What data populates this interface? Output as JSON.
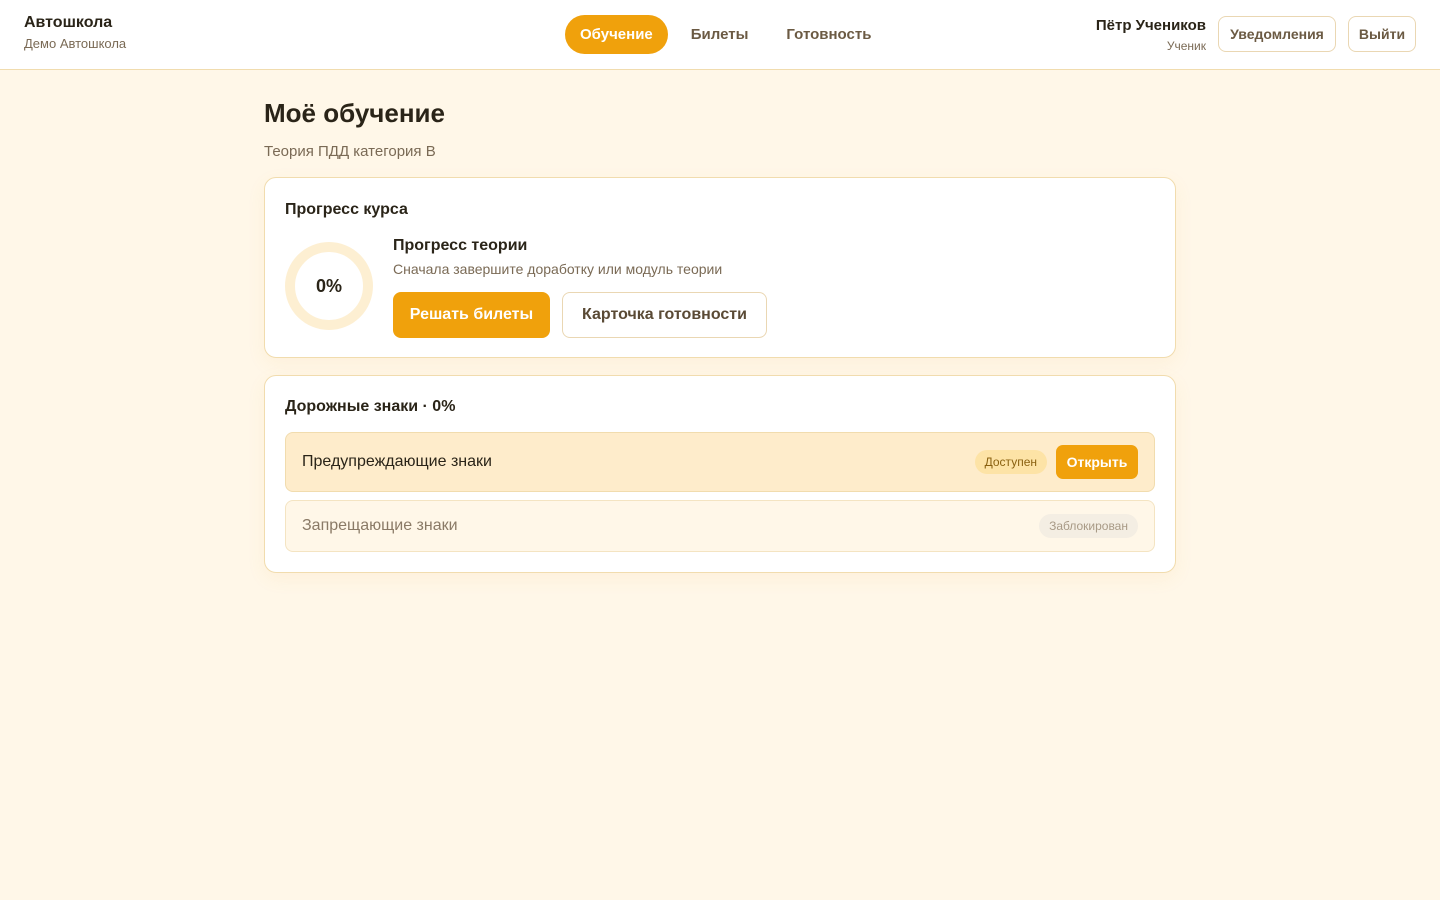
{
  "header": {
    "brand_title": "Автошкола",
    "brand_subtitle": "Демо Автошкола",
    "nav": [
      {
        "label": "Обучение",
        "active": true
      },
      {
        "label": "Билеты",
        "active": false
      },
      {
        "label": "Готовность",
        "active": false
      }
    ],
    "user_name": "Пётр Учеников",
    "user_role": "Ученик",
    "notifications_label": "Уведомления",
    "logout_label": "Выйти"
  },
  "page": {
    "title": "Моё обучение",
    "subtitle": "Теория ПДД категория B"
  },
  "progress_card": {
    "title": "Прогресс курса",
    "percent_label": "0%",
    "percent_value": 0,
    "theory_title": "Прогресс теории",
    "theory_subtitle": "Сначала завершите доработку или модуль теории",
    "primary_button": "Решать билеты",
    "secondary_button": "Карточка готовности"
  },
  "signs_card": {
    "title": "Дорожные знаки · 0%",
    "modules": [
      {
        "name": "Предупреждающие знаки",
        "status": "Доступен",
        "action": "Открыть"
      },
      {
        "name": "Запрещающие знаки",
        "status": "Заблокирован"
      }
    ]
  },
  "colors": {
    "accent": "#f0a10c",
    "background": "#fff7e8",
    "border": "#f1dcae"
  }
}
